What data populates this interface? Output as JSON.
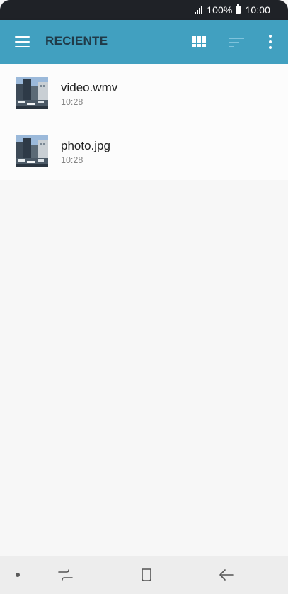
{
  "status_bar": {
    "battery": "100%",
    "time": "10:00"
  },
  "app_bar": {
    "title": "RECIENTE",
    "icons": [
      "menu-icon",
      "grid-view-icon",
      "sort-icon",
      "more-options-icon"
    ],
    "color": "#41a0c0"
  },
  "files": [
    {
      "name": "video.wmv",
      "time": "10:28",
      "icon": "image-thumbnail"
    },
    {
      "name": "photo.jpg",
      "time": "10:28",
      "icon": "image-thumbnail"
    }
  ],
  "nav_bar": {
    "icons": [
      "recent-apps-icon",
      "home-icon",
      "back-icon"
    ]
  }
}
